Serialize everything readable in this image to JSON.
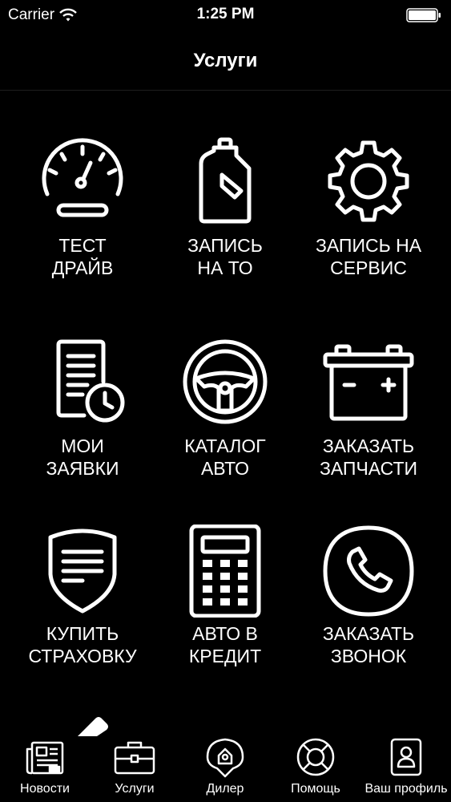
{
  "status": {
    "carrier": "Carrier",
    "time": "1:25 PM"
  },
  "header": {
    "title": "Услуги"
  },
  "services": [
    {
      "line1": "ТЕСТ",
      "line2": "ДРАЙВ",
      "icon": "speedometer-icon"
    },
    {
      "line1": "ЗАПИСЬ",
      "line2": "НА ТО",
      "icon": "oil-canister-icon"
    },
    {
      "line1": "ЗАПИСЬ НА",
      "line2": "СЕРВИС",
      "icon": "gear-icon"
    },
    {
      "line1": "МОИ",
      "line2": "ЗАЯВКИ",
      "icon": "document-clock-icon"
    },
    {
      "line1": "КАТАЛОГ",
      "line2": "АВТО",
      "icon": "steering-wheel-icon"
    },
    {
      "line1": "ЗАКАЗАТЬ",
      "line2": "ЗАПЧАСТИ",
      "icon": "battery-icon"
    },
    {
      "line1": "КУПИТЬ",
      "line2": "СТРАХОВКУ",
      "icon": "shield-document-icon"
    },
    {
      "line1": "АВТО В",
      "line2": "КРЕДИТ",
      "icon": "calculator-icon"
    },
    {
      "line1": "ЗАКАЗАТЬ",
      "line2": "ЗВОНОК",
      "icon": "phone-icon"
    }
  ],
  "tabs": [
    {
      "label": "Новости",
      "icon": "newspaper-icon"
    },
    {
      "label": "Услуги",
      "icon": "briefcase-icon",
      "selected": true
    },
    {
      "label": "Дилер",
      "icon": "dealer-location-icon"
    },
    {
      "label": "Помощь",
      "icon": "lifebuoy-icon"
    },
    {
      "label": "Ваш профиль",
      "icon": "profile-icon"
    }
  ]
}
